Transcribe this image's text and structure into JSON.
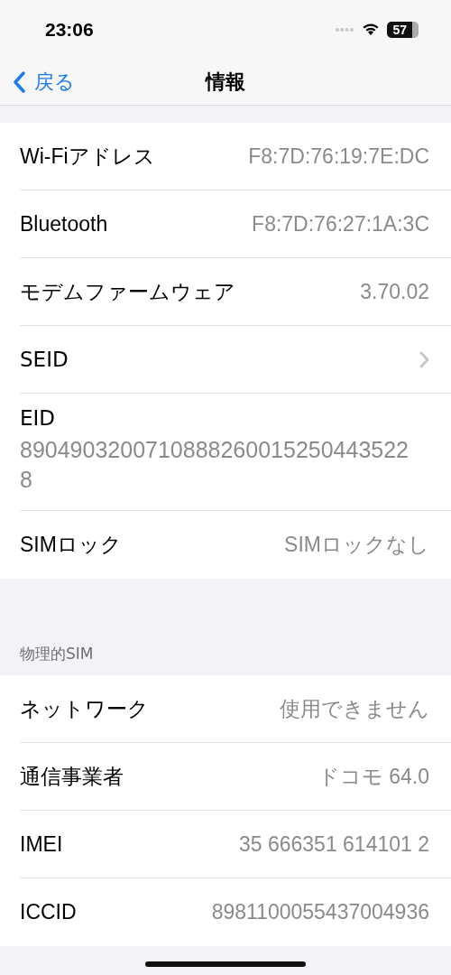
{
  "status_bar": {
    "time": "23:06",
    "battery": "57"
  },
  "nav": {
    "back": "戻る",
    "title": "情報"
  },
  "sections": [
    {
      "rows": [
        {
          "kind": "value",
          "label": "Wi-Fiアドレス",
          "value": "F8:7D:76:19:7E:DC"
        },
        {
          "kind": "value",
          "label": "Bluetooth",
          "value": "F8:7D:76:27:1A:3C"
        },
        {
          "kind": "value",
          "label": "モデムファームウェア",
          "value": "3.70.02"
        },
        {
          "kind": "chevron",
          "label": "SEID"
        },
        {
          "kind": "stacked",
          "label": "EID",
          "value": "89049032007108882600152504435228"
        },
        {
          "kind": "value",
          "label": "SIMロック",
          "value": "SIMロックなし"
        }
      ]
    },
    {
      "header": "物理的SIM",
      "rows": [
        {
          "kind": "value",
          "label": "ネットワーク",
          "value": "使用できません"
        },
        {
          "kind": "value",
          "label": "通信事業者",
          "value": "ドコモ 64.0"
        },
        {
          "kind": "value",
          "label": "IMEI",
          "value": "35 666351 614101 2"
        },
        {
          "kind": "value",
          "label": "ICCID",
          "value": "8981100055437004936"
        }
      ]
    }
  ]
}
